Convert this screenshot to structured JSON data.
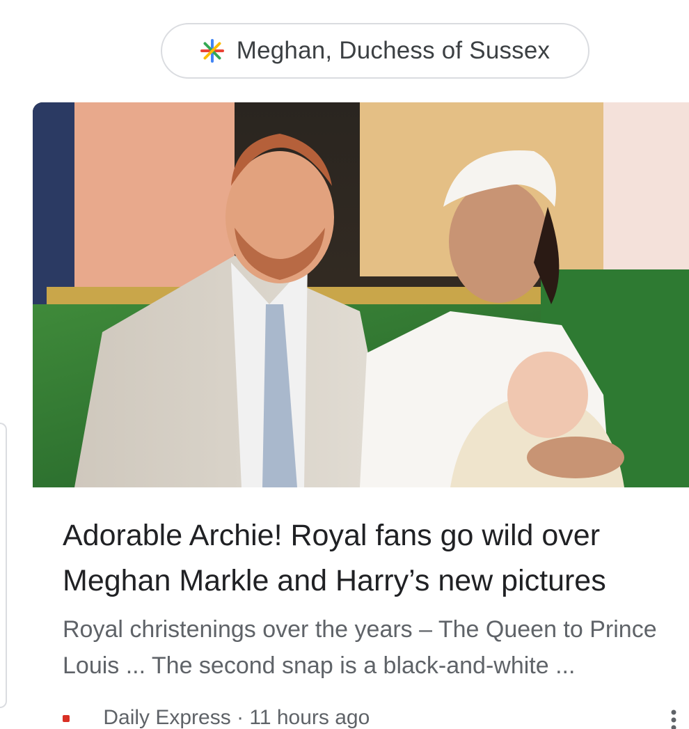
{
  "chip": {
    "label": "Meghan, Duchess of Sussex",
    "icon": "google-sparkle-icon"
  },
  "card": {
    "headline": "Adorable Archie! Royal fans go wild over Meghan Markle and Harry’s new pictures",
    "snippet": "Royal christenings over the years – The Queen to Prince Louis ... The second snap is a black-and-white ...",
    "source": "Daily Express · 11 hours ago",
    "more_icon": "more-vert-icon"
  },
  "colors": {
    "headline": "#202124",
    "snippet": "#5f6368",
    "chip_border": "#dadce0"
  }
}
